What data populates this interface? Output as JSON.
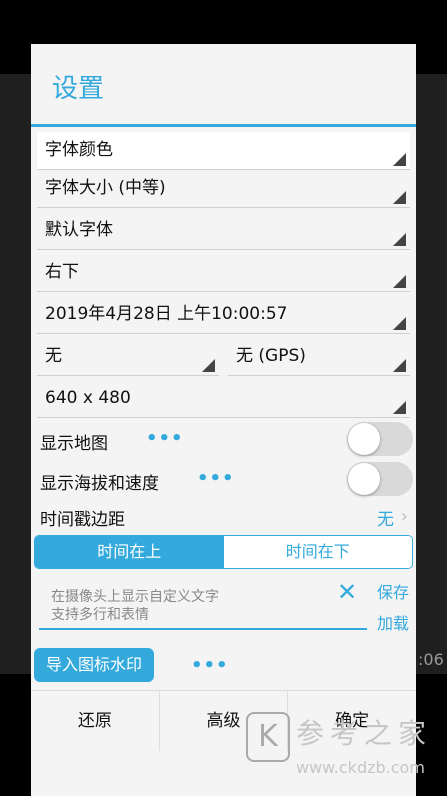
{
  "background": {
    "time_fragment": ":06"
  },
  "dialog": {
    "title": "设置",
    "spinners": {
      "font_color": "字体颜色",
      "font_size": "字体大小 (中等)",
      "font_family": "默认字体",
      "position": "右下",
      "datetime": "2019年4月28日 上午10:00:57",
      "location_left": "无",
      "location_right": "无 (GPS)",
      "resolution": "640 x 480"
    },
    "show_map": {
      "label": "显示地图",
      "more": "•••",
      "enabled": false
    },
    "show_altitude": {
      "label": "显示海拔和速度",
      "more": "•••",
      "enabled": false
    },
    "timestamp_margin": {
      "label": "时间戳边距",
      "value": "无",
      "chevron": "›"
    },
    "time_position": {
      "options": [
        "时间在上",
        "时间在下"
      ],
      "selected": 0
    },
    "custom_text": {
      "placeholder": "在摄像头上显示自定义文字\n支持多行和表情",
      "clear": "✕",
      "save": "保存",
      "load": "加载"
    },
    "import_logo": {
      "label": "导入图标水印",
      "more": "•••"
    },
    "buttons": {
      "restore": "还原",
      "advanced": "高级",
      "confirm": "确定"
    }
  },
  "watermark": {
    "logo_letter": "K",
    "chinese": "参考之家",
    "url": "www.ckdzb.com"
  },
  "colors": {
    "accent": "#33a9dc",
    "dialog_bg": "#f4f4f4"
  }
}
